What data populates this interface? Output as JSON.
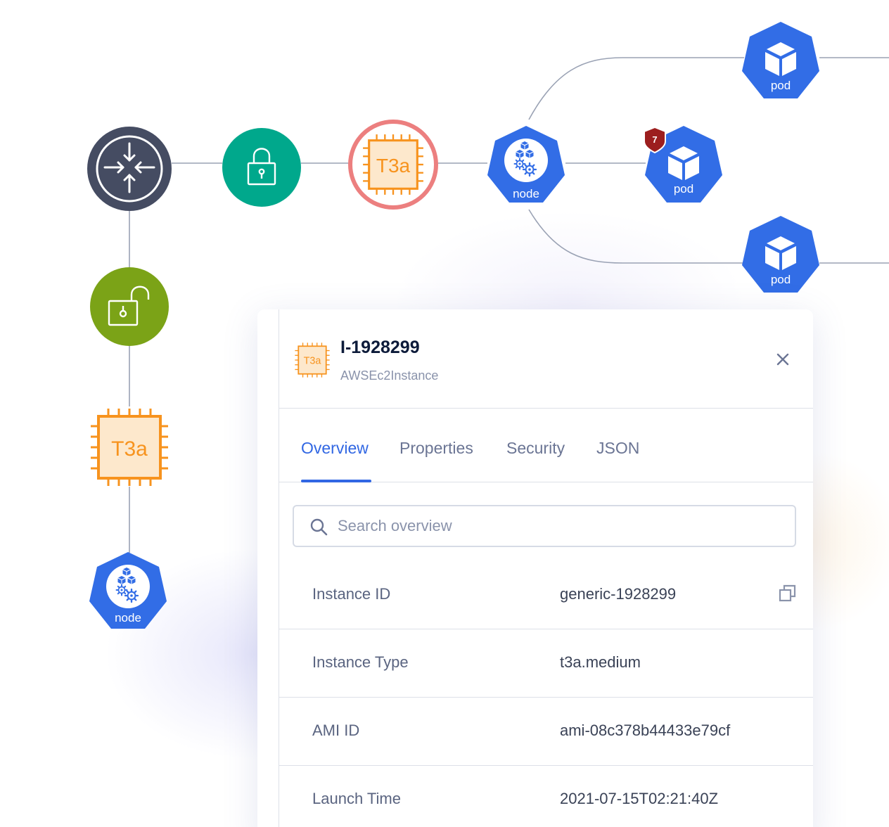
{
  "graph": {
    "node_label": "node",
    "pod_label": "pod",
    "chip_label": "T3a",
    "alert_badge_count": "7",
    "colors": {
      "router": "#454c62",
      "locked_gateway": "#00a88c",
      "unlocked_gateway": "#7ba317",
      "kubernetes": "#326de6",
      "instance_chip": "#F7931E",
      "instance_chip_fill": "#FDE8CC",
      "alert_ring": "#ec7f7f",
      "alert_badge": "#9c1e1e",
      "edge": "#9aa2b4"
    }
  },
  "panel": {
    "title": "I-1928299",
    "subtitle": "AWSEc2Instance",
    "header_icon": "t3a-chip-icon",
    "close_icon": "close-icon",
    "tabs": [
      {
        "label": "Overview",
        "active": true
      },
      {
        "label": "Properties",
        "active": false
      },
      {
        "label": "Security",
        "active": false
      },
      {
        "label": "JSON",
        "active": false
      }
    ],
    "search": {
      "placeholder": "Search overview",
      "value": ""
    },
    "properties": [
      {
        "label": "Instance ID",
        "value": "generic-1928299",
        "copyable": true
      },
      {
        "label": "Instance Type",
        "value": "t3a.medium",
        "copyable": false
      },
      {
        "label": "AMI ID",
        "value": "ami-08c378b44433e79cf",
        "copyable": false
      },
      {
        "label": "Launch Time",
        "value": "2021-07-15T02:21:40Z",
        "copyable": false
      }
    ],
    "colors": {
      "accent": "#3167e3",
      "title": "#0d1b3a",
      "muted": "#8a93ab"
    }
  }
}
